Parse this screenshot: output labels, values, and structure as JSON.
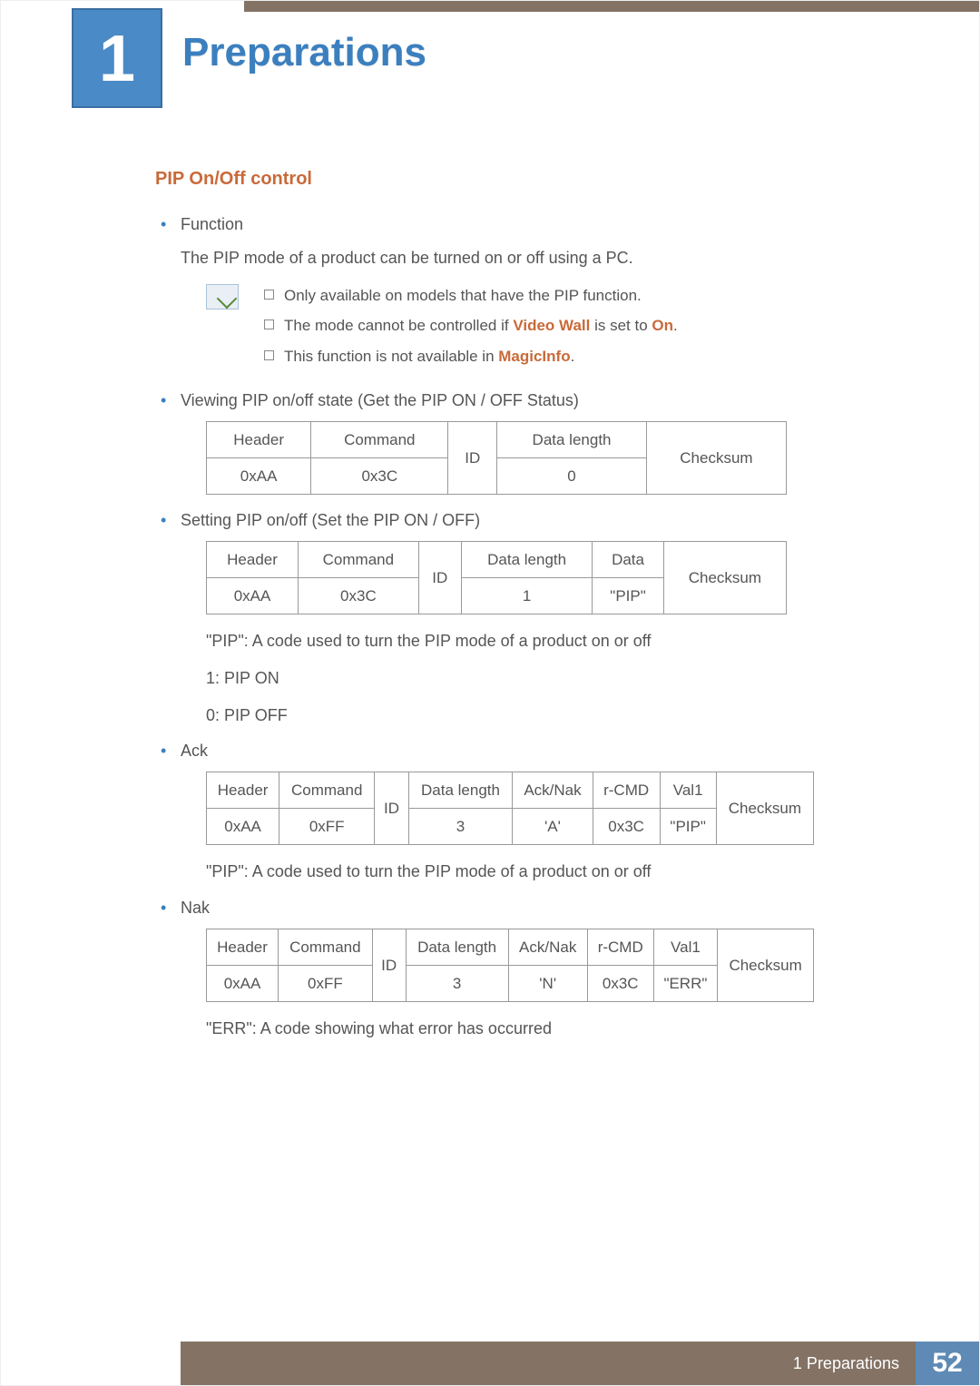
{
  "chapter": {
    "number": "1",
    "title": "Preparations"
  },
  "section": {
    "heading": "PIP On/Off control"
  },
  "bullets": {
    "function_label": "Function",
    "function_desc": "The PIP mode of a product can be turned on or off using a PC.",
    "viewing_label": "Viewing PIP on/off state (Get the PIP ON / OFF Status)",
    "setting_label": "Setting PIP on/off (Set the PIP ON / OFF)",
    "ack_label": "Ack",
    "nak_label": "Nak"
  },
  "notes": {
    "n1": "Only available on models that have the PIP function.",
    "n2_pre": "The mode cannot be controlled if ",
    "n2_hl1": "Video Wall",
    "n2_mid": " is set to ",
    "n2_hl2": "On",
    "n2_post": ".",
    "n3_pre": "This function is not available in ",
    "n3_hl": "MagicInfo",
    "n3_post": "."
  },
  "table_headers": {
    "header": "Header",
    "command": "Command",
    "id": "ID",
    "data_length": "Data length",
    "checksum": "Checksum",
    "data": "Data",
    "acknak": "Ack/Nak",
    "rcmd": "r-CMD",
    "val1": "Val1"
  },
  "table1": {
    "header_val": "0xAA",
    "command_val": "0x3C",
    "data_length_val": "0"
  },
  "table2": {
    "header_val": "0xAA",
    "command_val": "0x3C",
    "data_length_val": "1",
    "data_val": "\"PIP\""
  },
  "table2_after": {
    "line1": "\"PIP\": A code used to turn the PIP mode of a product on or off",
    "line2": "1: PIP ON",
    "line3": "0: PIP OFF"
  },
  "table3": {
    "header_val": "0xAA",
    "command_val": "0xFF",
    "data_length_val": "3",
    "acknak_val": "'A'",
    "rcmd_val": "0x3C",
    "val1_val": "\"PIP\""
  },
  "table3_after": "\"PIP\": A code used to turn the PIP mode of a product on or off",
  "table4": {
    "header_val": "0xAA",
    "command_val": "0xFF",
    "data_length_val": "3",
    "acknak_val": "'N'",
    "rcmd_val": "0x3C",
    "val1_val": "\"ERR\""
  },
  "table4_after": "\"ERR\": A code showing what error has occurred",
  "footer": {
    "text": "1 Preparations",
    "page": "52"
  }
}
